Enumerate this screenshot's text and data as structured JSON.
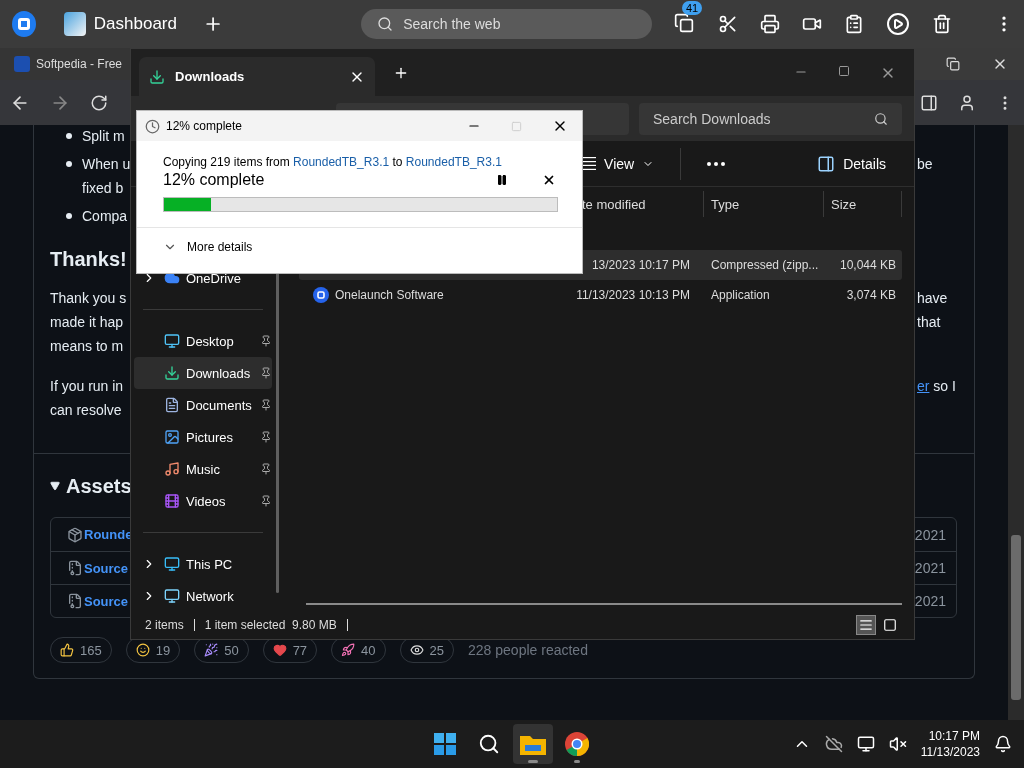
{
  "top_bar": {
    "tab": "Dashboard",
    "search_placeholder": "Search the web",
    "badge": "41"
  },
  "browser": {
    "tab": "Softpedia - Free",
    "article": {
      "blocks": [
        {
          "kind": "list",
          "items": [
            {
              "lines": [
                {
                  "left": "Split m"
                }
              ]
            },
            {
              "lines": [
                {
                  "left": "When u",
                  "right": "be"
                },
                {
                  "left": "fixed b"
                }
              ]
            },
            {
              "lines": [
                {
                  "left": "Compa"
                }
              ]
            }
          ]
        },
        {
          "kind": "heading",
          "text": "Thanks!"
        },
        {
          "kind": "paragraph",
          "lines": [
            {
              "left": "Thank you s",
              "right": "have"
            },
            {
              "left": "made it hap",
              "right": "that"
            },
            {
              "left": "means to m"
            }
          ]
        },
        {
          "kind": "paragraph",
          "lines": [
            {
              "left": "If you run in",
              "right_link": "er",
              "right": "so I"
            },
            {
              "left": "can resolve"
            }
          ]
        }
      ]
    },
    "assets": {
      "title": "Assets",
      "expanded": true,
      "rows": [
        {
          "kind": "package",
          "name": "Rounde",
          "date": "2021"
        },
        {
          "kind": "zip",
          "name": "Source",
          "date": "2021"
        },
        {
          "kind": "zip",
          "name": "Source",
          "date": "2021"
        }
      ]
    },
    "reactions": [
      {
        "kind": "thumbs",
        "count": "165"
      },
      {
        "kind": "smile",
        "count": "19"
      },
      {
        "kind": "party",
        "count": "50"
      },
      {
        "kind": "heart",
        "count": "77"
      },
      {
        "kind": "rocket",
        "count": "40"
      },
      {
        "kind": "eyes",
        "count": "25"
      }
    ],
    "reacted": "228 people reacted"
  },
  "explorer": {
    "tab": "Downloads",
    "search_placeholder": "Search Downloads",
    "view": "View",
    "details": "Details",
    "columns": [
      "te modified",
      "Type",
      "Size"
    ],
    "sidebar": [
      {
        "kind": "cloud",
        "label": "OneDrive",
        "pinned": false,
        "selected": false,
        "expandable": true
      },
      {
        "kind": "divider"
      },
      {
        "kind": "desktop",
        "label": "Desktop",
        "pinned": true,
        "selected": false,
        "expandable": false
      },
      {
        "kind": "downloads",
        "label": "Downloads",
        "pinned": true,
        "selected": true,
        "expandable": false
      },
      {
        "kind": "documents",
        "label": "Documents",
        "pinned": true,
        "selected": false,
        "expandable": false
      },
      {
        "kind": "pictures",
        "label": "Pictures",
        "pinned": true,
        "selected": false,
        "expandable": false
      },
      {
        "kind": "music",
        "label": "Music",
        "pinned": true,
        "selected": false,
        "expandable": false
      },
      {
        "kind": "videos",
        "label": "Videos",
        "pinned": true,
        "selected": false,
        "expandable": false
      },
      {
        "kind": "divider"
      },
      {
        "kind": "pc",
        "label": "This PC",
        "pinned": false,
        "selected": false,
        "expandable": true
      },
      {
        "kind": "network",
        "label": "Network",
        "pinned": false,
        "selected": false,
        "expandable": true
      }
    ],
    "files": [
      {
        "kind": "hidden",
        "date": "13/2023 10:17 PM",
        "type": "Compressed (zipp...",
        "size": "10,044 KB",
        "selected": true
      },
      {
        "kind": "app",
        "name": "Onelaunch Software",
        "date": "11/13/2023 10:13 PM",
        "type": "Application",
        "size": "3,074 KB",
        "selected": false
      }
    ],
    "status": {
      "count": "2 items",
      "selection": "1 item selected  9.80 MB"
    }
  },
  "dialog": {
    "title": "12% complete",
    "prefix": "Copying 219 items from",
    "source": "RoundedTB_R3.1",
    "middle": "to",
    "destination": "RoundedTB_R3.1",
    "heading": "12% complete",
    "level": 0.12,
    "more": "More details"
  },
  "taskbar": {
    "apps": [
      {
        "kind": "start",
        "selected": false
      },
      {
        "kind": "search",
        "selected": false
      },
      {
        "kind": "explorer",
        "selected": true
      },
      {
        "kind": "chrome",
        "selected": false
      }
    ],
    "time": "10:17 PM",
    "date": "11/13/2023"
  }
}
